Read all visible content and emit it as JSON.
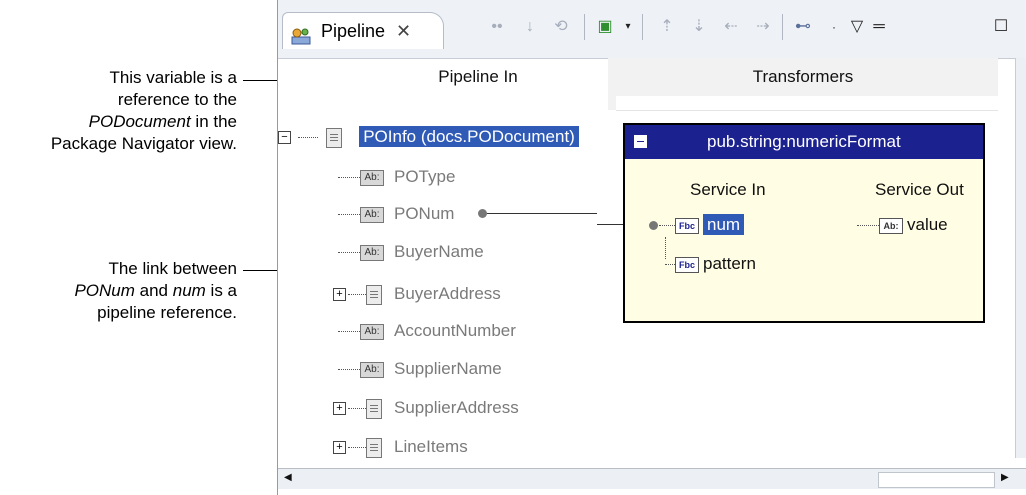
{
  "annotations": {
    "variable_note": {
      "line1": "This variable is a",
      "line2": "reference to the",
      "line3_em": "PODocument",
      "line3_rest": " in the",
      "line4": "Package Navigator view."
    },
    "link_note": {
      "line1": "The link between",
      "line2_em1": "PONum",
      "line2_mid": " and ",
      "line2_em2": "num",
      "line2_rest": " is a",
      "line3": "pipeline reference."
    }
  },
  "tab": {
    "label": "Pipeline",
    "close": "✕"
  },
  "toolbar": {
    "icons": [
      "link-icon",
      "map-icon",
      "drop-icon",
      "insert-transformer-icon",
      "dropdown-arrow-icon",
      "shift-up-icon",
      "shift-down-icon",
      "shift-left-icon",
      "shift-right-icon",
      "layout-icon",
      "menu-icon",
      "minimize-icon",
      "maximize-icon"
    ]
  },
  "columns": {
    "pipeline_in": "Pipeline In",
    "transformers": "Transformers"
  },
  "tree": {
    "root": {
      "label": "POInfo (docs.PODocument)"
    },
    "items": [
      {
        "icon": "Ab:",
        "label": "POType"
      },
      {
        "icon": "Ab:",
        "label": "PONum"
      },
      {
        "icon": "Ab:",
        "label": "BuyerName"
      },
      {
        "icon": "doc",
        "label": "BuyerAddress"
      },
      {
        "icon": "Ab:",
        "label": "AccountNumber"
      },
      {
        "icon": "Ab:",
        "label": "SupplierName"
      },
      {
        "icon": "doc",
        "label": "SupplierAddress"
      },
      {
        "icon": "doclist",
        "label": "LineItems"
      }
    ]
  },
  "service": {
    "title": "pub.string:numericFormat",
    "service_in": "Service In",
    "service_out": "Service Out",
    "inputs": [
      {
        "icon": "Fbc",
        "label": "num"
      },
      {
        "icon": "Fbc",
        "label": "pattern"
      }
    ],
    "outputs": [
      {
        "icon": "Ab:",
        "label": "value"
      }
    ]
  }
}
